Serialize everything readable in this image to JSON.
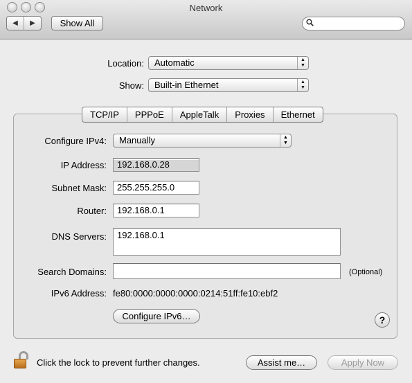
{
  "window": {
    "title": "Network"
  },
  "toolbar": {
    "back_glyph": "◀",
    "forward_glyph": "▶",
    "show_all": "Show All",
    "search_placeholder": ""
  },
  "location": {
    "label": "Location:",
    "value": "Automatic"
  },
  "show": {
    "label": "Show:",
    "value": "Built-in Ethernet"
  },
  "tabs": [
    {
      "label": "TCP/IP",
      "selected": true
    },
    {
      "label": "PPPoE"
    },
    {
      "label": "AppleTalk"
    },
    {
      "label": "Proxies"
    },
    {
      "label": "Ethernet"
    }
  ],
  "tcpip": {
    "configure_label": "Configure IPv4:",
    "configure_value": "Manually",
    "ip_label": "IP Address:",
    "ip_value": "192.168.0.28",
    "subnet_label": "Subnet Mask:",
    "subnet_value": "255.255.255.0",
    "router_label": "Router:",
    "router_value": "192.168.0.1",
    "dns_label": "DNS Servers:",
    "dns_value": "192.168.0.1",
    "search_label": "Search Domains:",
    "search_value": "",
    "search_hint": "(Optional)",
    "ipv6_label": "IPv6 Address:",
    "ipv6_value": "fe80:0000:0000:0000:0214:51ff:fe10:ebf2",
    "configure_ipv6": "Configure IPv6…",
    "help": "?"
  },
  "footer": {
    "lock_text": "Click the lock to prevent further changes.",
    "assist": "Assist me…",
    "apply": "Apply Now"
  }
}
